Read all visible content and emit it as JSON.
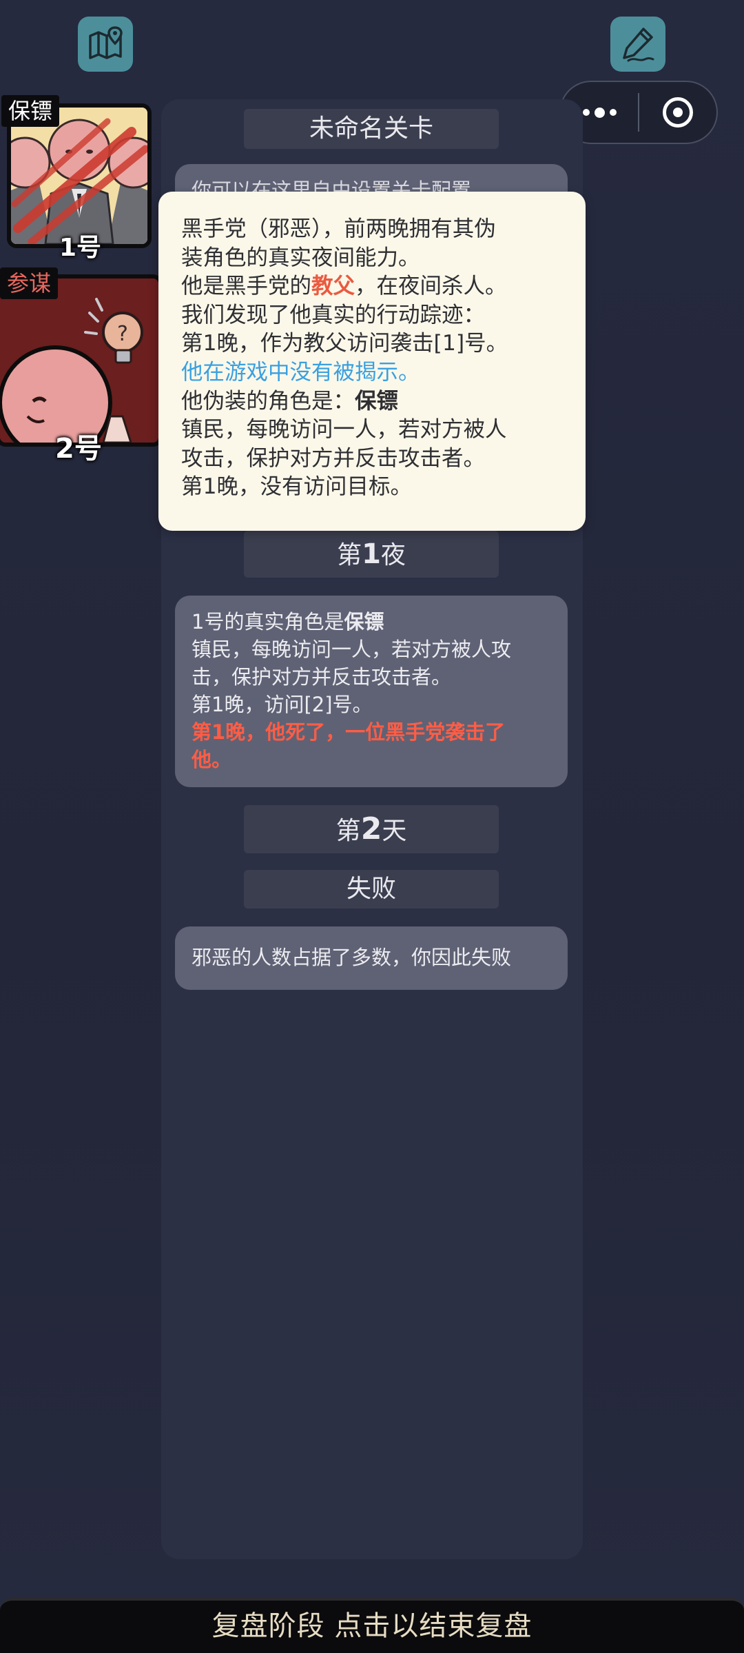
{
  "top_bar": {
    "map_icon": "map-icon",
    "edit_icon": "edit-icon",
    "more_icon": "more-dots-icon",
    "close_icon": "target-icon"
  },
  "players": [
    {
      "role": "保镖",
      "number": "1号",
      "tag_color": "#ffffff"
    },
    {
      "role": "参谋",
      "number": "2号",
      "tag_color": "#e8685f"
    }
  ],
  "panel": {
    "level_title": "未命名关卡",
    "intro_partial": "你可以在这里自由设置关卡配置",
    "night1_title_prefix": "第",
    "night1_title_num": "1",
    "night1_title_suffix": "夜",
    "night1_bubble": {
      "line1_a": "1号的真实角色是",
      "line1_b": "保镖",
      "line2": "镇民，每晚访问一人，若对方被人攻",
      "line3": "击，保护对方并反击攻击者。",
      "line4": "第1晚，访问[2]号。",
      "line5": "第1晚，他死了，一位黑手党袭击了",
      "line6": "他。"
    },
    "day2_title_prefix": "第",
    "day2_title_num": "2",
    "day2_title_suffix": "天",
    "result_title": "失败",
    "result_text": "邪恶的人数占据了多数，你因此失败"
  },
  "tooltip": {
    "line1": "黑手党（邪恶），前两晚拥有其伪",
    "line2": "装角色的真实夜间能力。",
    "line3_a": "他是黑手党的",
    "line3_b": "教父",
    "line3_c": "，在夜间杀人。",
    "line4": "我们发现了他真实的行动踪迹：",
    "line5": "第1晚，作为教父访问袭击[1]号。",
    "line6": "他在游戏中没有被揭示。",
    "line7_a": "他伪装的角色是：",
    "line7_b": "保镖",
    "line8": "镇民，每晚访问一人，若对方被人",
    "line9": "攻击，保护对方并反击攻击者。",
    "line10": "第1晚，没有访问目标。"
  },
  "bottom_bar": {
    "label": "复盘阶段 点击以结束复盘"
  },
  "colors": {
    "background": "#262a3d",
    "accent_teal": "#4c8f9b",
    "highlight_red": "#ff5d45",
    "highlight_blue": "#3aa0e0"
  }
}
